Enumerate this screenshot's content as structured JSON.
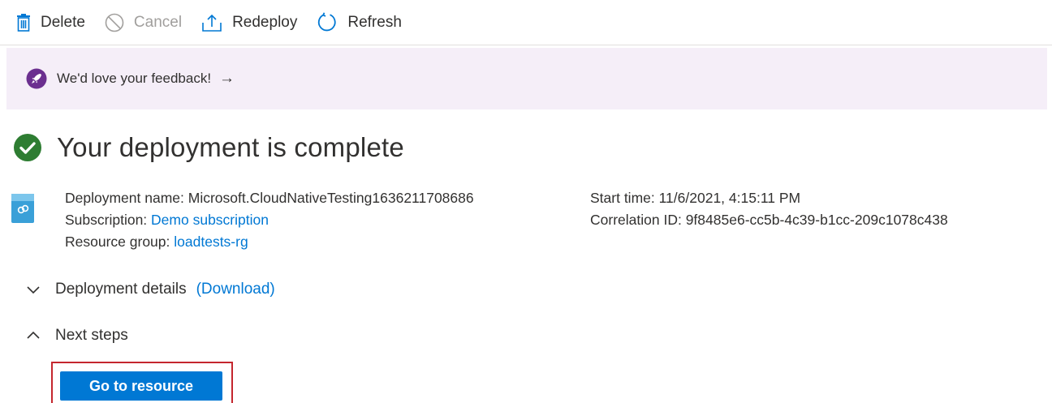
{
  "toolbar": {
    "delete_label": "Delete",
    "cancel_label": "Cancel",
    "redeploy_label": "Redeploy",
    "refresh_label": "Refresh"
  },
  "banner": {
    "text": "We'd love your feedback!",
    "arrow": "→"
  },
  "title": "Your deployment is complete",
  "deployment": {
    "name_label": "Deployment name:",
    "name_value": "Microsoft.CloudNativeTesting1636211708686",
    "subscription_label": "Subscription:",
    "subscription_value": "Demo subscription",
    "resource_group_label": "Resource group:",
    "resource_group_value": "loadtests-rg",
    "start_time_label": "Start time:",
    "start_time_value": "11/6/2021, 4:15:11 PM",
    "correlation_label": "Correlation ID:",
    "correlation_value": "9f8485e6-cc5b-4c39-b1cc-209c1078c438"
  },
  "sections": {
    "details_label": "Deployment details",
    "download_label": "(Download)",
    "next_steps_label": "Next steps"
  },
  "actions": {
    "go_to_resource_label": "Go to resource"
  },
  "icons": {
    "delete": "trash-icon",
    "cancel": "cancel-icon",
    "redeploy": "upload-icon",
    "refresh": "refresh-icon",
    "feedback": "rocket-icon",
    "status": "checkmark-circle-icon",
    "deployment": "deployment-icon",
    "details_toggle": "chevron-down-icon",
    "next_steps_toggle": "chevron-up-icon"
  },
  "colors": {
    "accent": "#0078d4",
    "success": "#2e7d32",
    "feedback": "#6b2f8f",
    "banner_bg": "#f5eef8",
    "highlight": "#c4262e"
  }
}
